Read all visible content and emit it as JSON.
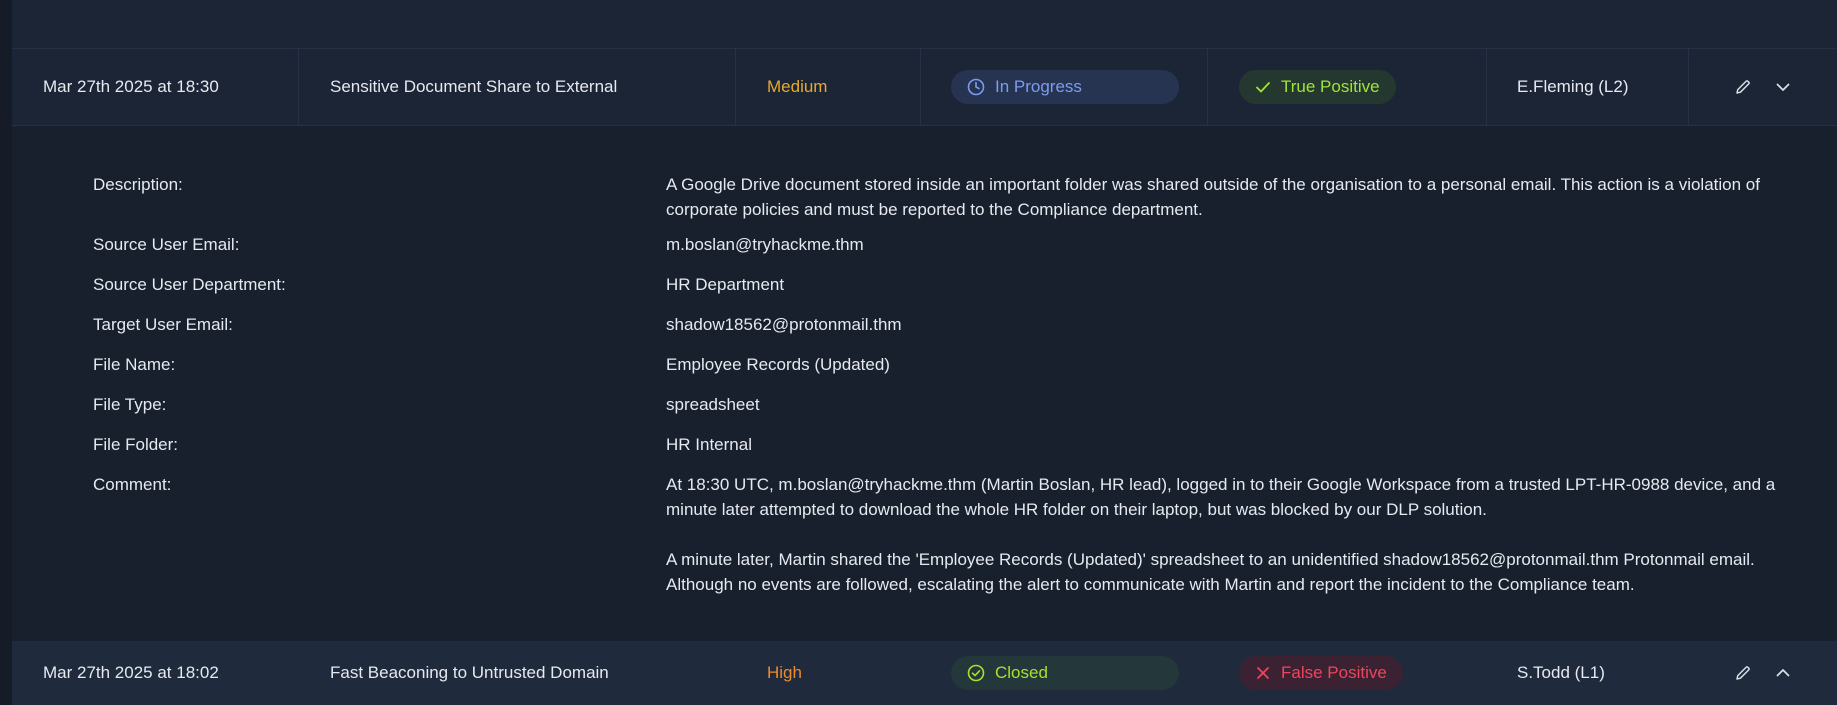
{
  "alerts": [
    {
      "date": "Mar 27th 2025 at 18:30",
      "name": "Sensitive Document Share to External",
      "severity": "Medium",
      "status": "In Progress",
      "verdict": "True Positive",
      "assignee": "E.Fleming (L2)"
    },
    {
      "date": "Mar 27th 2025 at 18:02",
      "name": "Fast Beaconing to Untrusted Domain",
      "severity": "High",
      "status": "Closed",
      "verdict": "False Positive",
      "assignee": "S.Todd (L1)"
    }
  ],
  "details": [
    {
      "label": "Description:",
      "value": "A Google Drive document stored inside an important folder was shared outside of the organisation to a personal email. This action is a violation of corporate policies and must be reported to the Compliance department."
    },
    {
      "label": "Source User Email:",
      "value": "m.boslan@tryhackme.thm"
    },
    {
      "label": "Source User Department:",
      "value": "HR Department"
    },
    {
      "label": "Target User Email:",
      "value": "shadow18562@protonmail.thm"
    },
    {
      "label": "File Name:",
      "value": "Employee Records (Updated)"
    },
    {
      "label": "File Type:",
      "value": "spreadsheet"
    },
    {
      "label": "File Folder:",
      "value": "HR Internal"
    },
    {
      "label": "Comment:",
      "value": "At 18:30 UTC, m.boslan@tryhackme.thm (Martin Boslan, HR lead), logged in to their Google Workspace from a trusted LPT-HR-0988 device, and a minute later attempted to download the whole HR folder on their laptop, but was blocked by our DLP solution.\n\n A minute later, Martin shared the 'Employee Records (Updated)' spreadsheet to an unidentified shadow18562@protonmail.thm Protonmail email. Although no events are followed, escalating the alert to communicate with Martin and report the incident to the Compliance team."
    }
  ],
  "colors": {
    "background": "#18202e",
    "row": "#1c2536",
    "medium": "#e7a92d",
    "high": "#f08a2a",
    "in_progress": "#7d9cf0",
    "closed": "#a6e22e",
    "true_positive": "#9fe43a",
    "false_positive": "#f0445c"
  },
  "icons": {
    "status_in_progress": "clock-icon",
    "status_closed": "check-circle-icon",
    "verdict_true": "check-icon",
    "verdict_false": "x-icon",
    "edit": "pencil-icon",
    "expand": "chevron-down-icon",
    "collapse": "chevron-up-icon"
  }
}
